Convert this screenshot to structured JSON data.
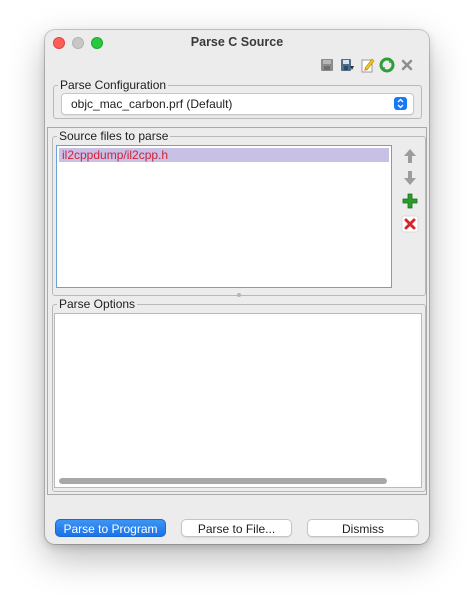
{
  "window": {
    "title": "Parse C Source"
  },
  "toolbar": {
    "icons": [
      "save-icon",
      "save-as-icon",
      "clear-icon",
      "refresh-icon",
      "delete-icon"
    ]
  },
  "parse_configuration": {
    "legend": "Parse Configuration",
    "selected": "objc_mac_carbon.prf (Default)"
  },
  "source_files": {
    "legend": "Source files to parse",
    "items": [
      "il2cppdump/il2cpp.h"
    ]
  },
  "side_buttons": {
    "icons": [
      "move-up-icon",
      "move-down-icon",
      "add-icon",
      "remove-icon"
    ]
  },
  "parse_options": {
    "legend": "Parse Options"
  },
  "buttons": {
    "parse_to_program": "Parse to Program",
    "parse_to_file": "Parse to File...",
    "dismiss": "Dismiss"
  },
  "colors": {
    "accent": "#1a78f2",
    "selection_bg": "#c9c0e6",
    "selection_text": "#d2203a",
    "add_green": "#2a9d2a",
    "remove_red": "#d62828"
  }
}
